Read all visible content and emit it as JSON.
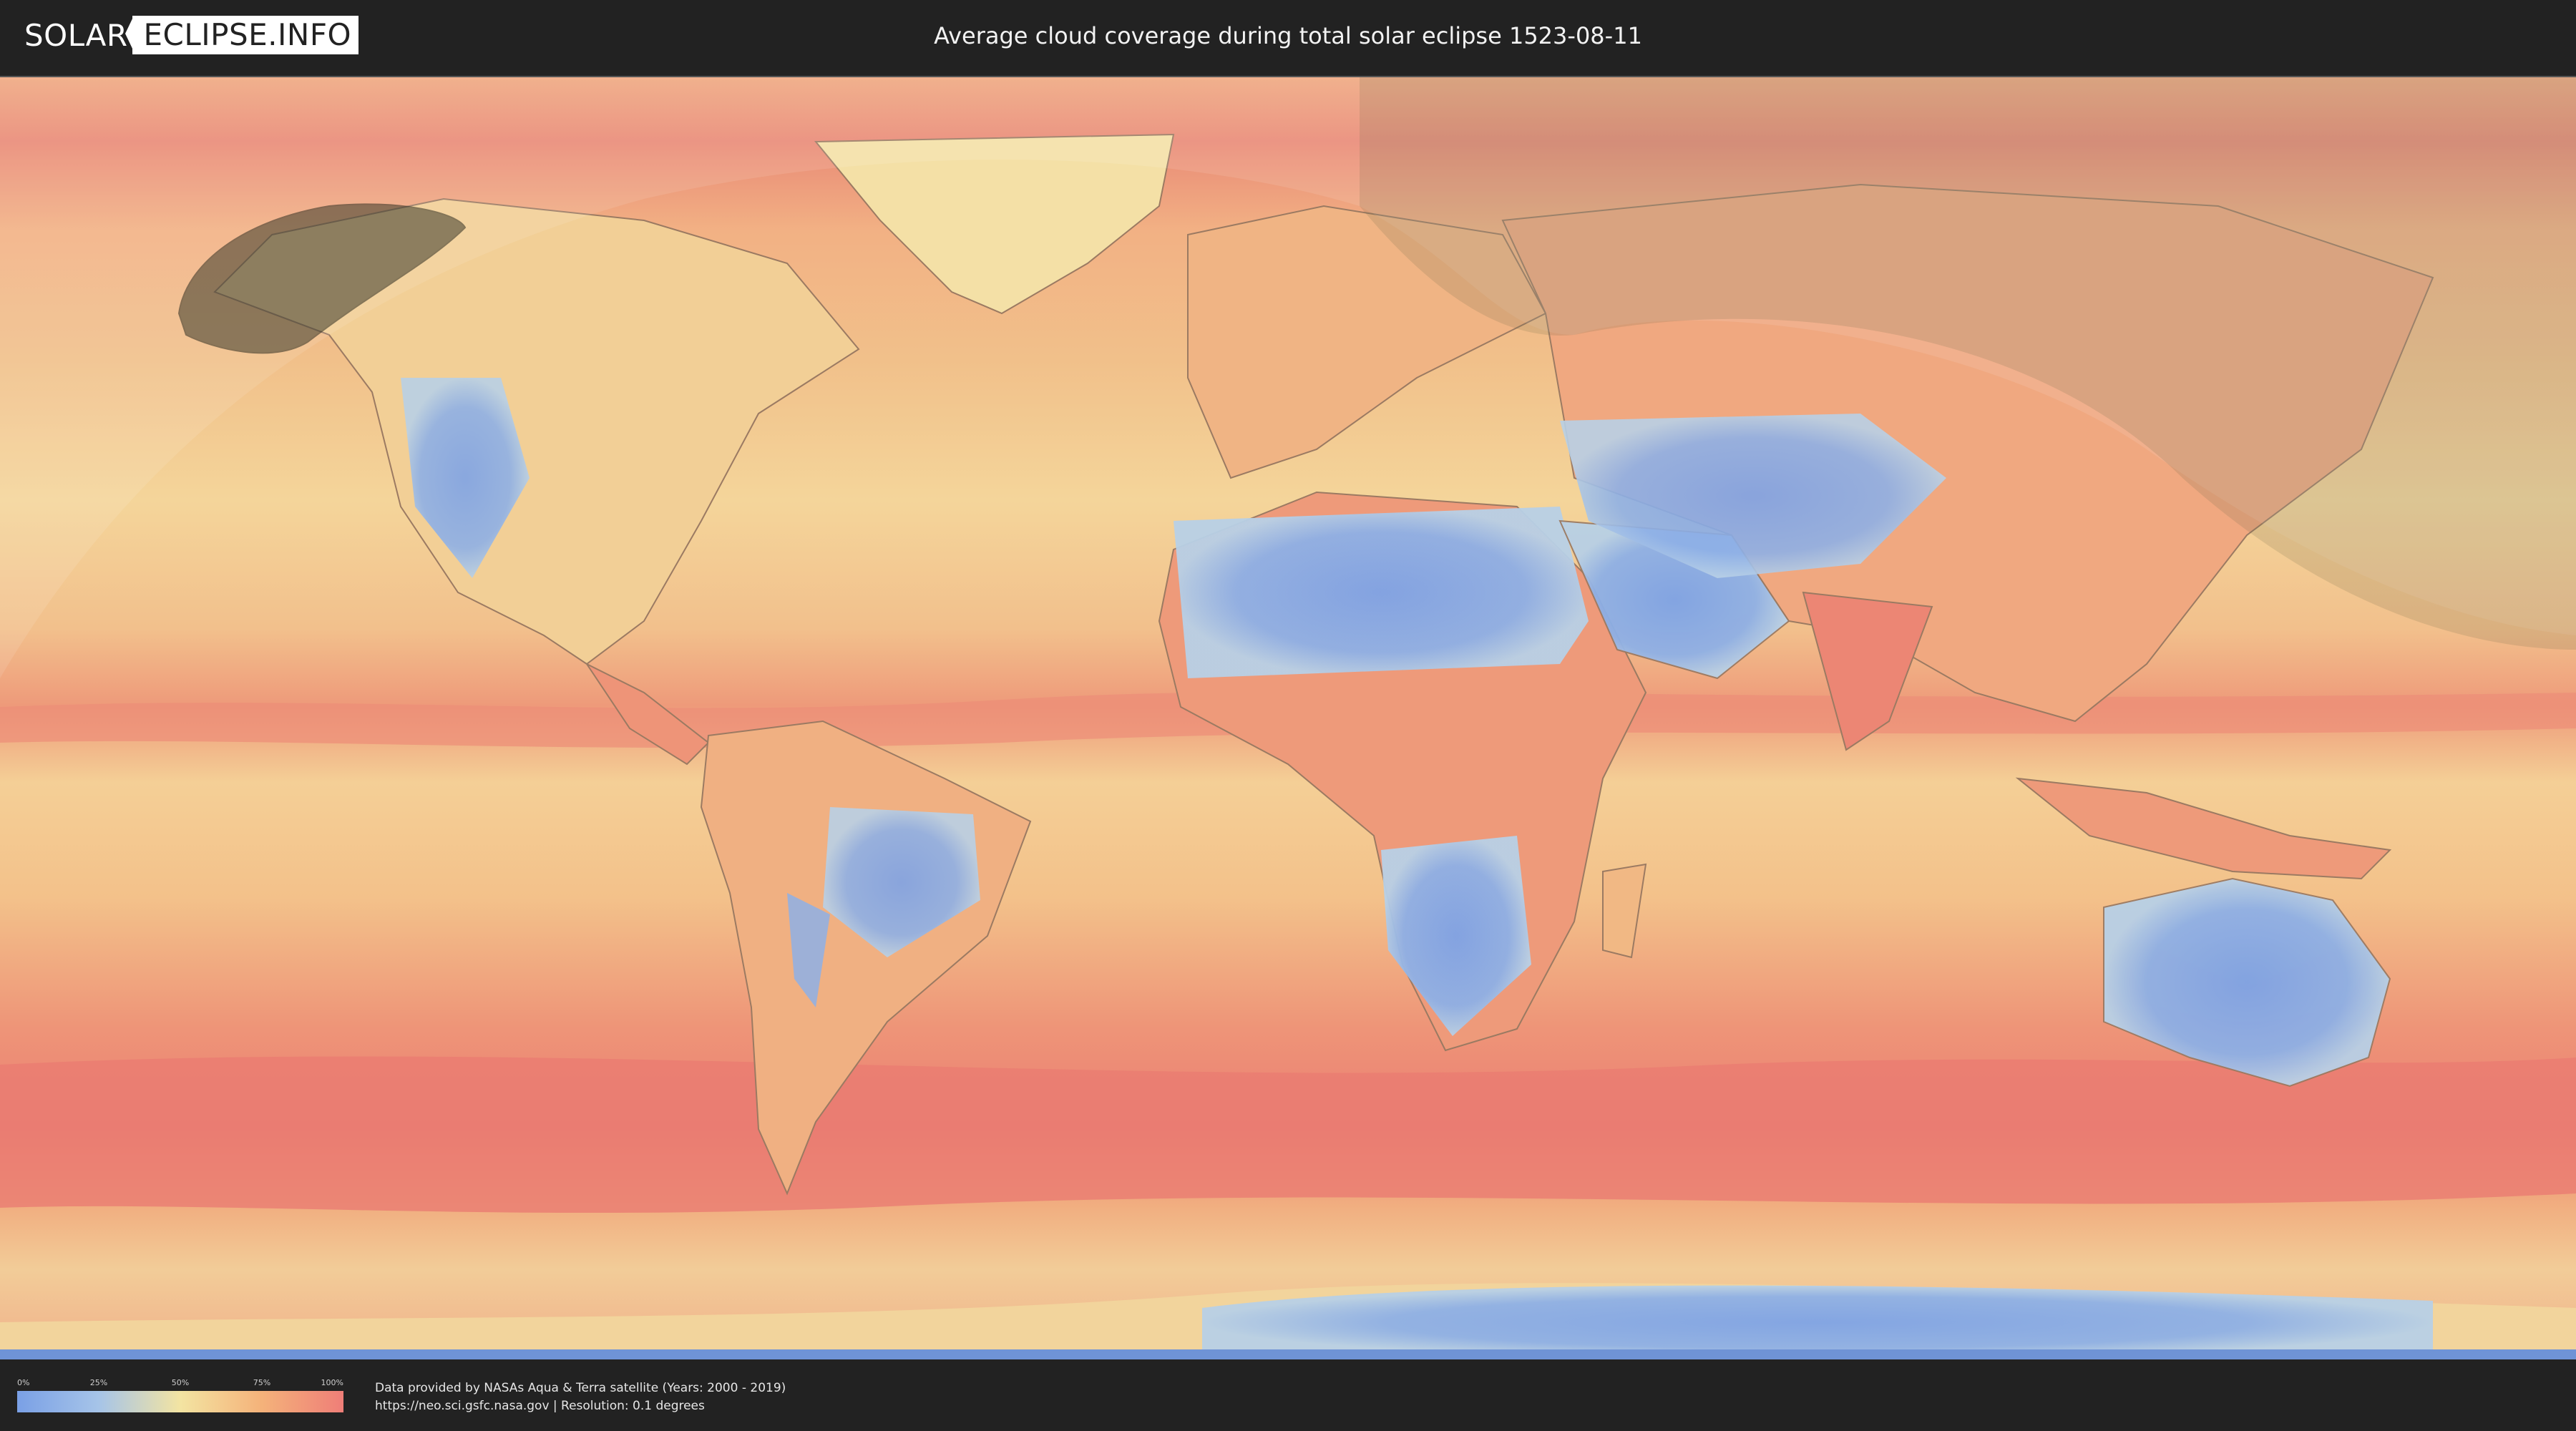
{
  "header": {
    "logo": {
      "part1": "SOLAR",
      "part2": "ECLIPSE.INFO"
    },
    "title": "Average cloud coverage during total solar eclipse 1523-08-11"
  },
  "legend": {
    "ticks": [
      "0%",
      "25%",
      "50%",
      "75%",
      "100%"
    ],
    "colors": [
      "#7aa0e6",
      "#a6c4e8",
      "#f3e4a2",
      "#f4b27a",
      "#ef7e78"
    ]
  },
  "credits": {
    "line1": "Data provided by NASAs Aqua & Terra satellite (Years: 2000 - 2019)",
    "line2": "https://neo.sci.gsfc.nasa.gov | Resolution: 0.1 degrees"
  },
  "map": {
    "palette": {
      "clear": "#7ea3e6",
      "low": "#b8d0e6",
      "mid": "#f2dea0",
      "high": "#f4aa78",
      "overcast": "#ec7d74",
      "night_shade": "#3a3a2a"
    }
  }
}
